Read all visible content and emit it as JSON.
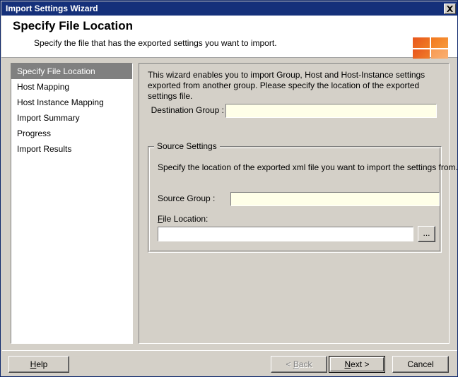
{
  "window": {
    "title": "Import Settings Wizard",
    "close_icon": "close-icon",
    "close_label": "X"
  },
  "header": {
    "title": "Specify File Location",
    "subtitle": "Specify the file that has the exported settings you want to import.",
    "logo_name": "microsoft-logo"
  },
  "sidebar": {
    "items": [
      {
        "label": "Specify File Location",
        "selected": true
      },
      {
        "label": "Host Mapping",
        "selected": false
      },
      {
        "label": "Host Instance Mapping",
        "selected": false
      },
      {
        "label": "Import Summary",
        "selected": false
      },
      {
        "label": "Progress",
        "selected": false
      },
      {
        "label": "Import Results",
        "selected": false
      }
    ]
  },
  "content": {
    "intro": "This wizard enables you to import Group, Host and Host-Instance settings exported from another group. Please specify the location of the exported settings file.",
    "destination_group": {
      "label": "Destination Group :",
      "value": "",
      "placeholder": ""
    },
    "source_settings": {
      "legend": "Source Settings",
      "description": "Specify the location of the exported xml file you want to import the settings from.",
      "source_group": {
        "label": "Source Group :",
        "value": "",
        "placeholder": ""
      },
      "file_location": {
        "label_accel": "F",
        "label_rest": "ile Location:",
        "value": "",
        "placeholder": "",
        "browse_label": "..."
      }
    }
  },
  "footer": {
    "help": {
      "accel": "H",
      "rest": "elp"
    },
    "back": {
      "prefix": "< ",
      "accel": "B",
      "rest": "ack"
    },
    "next": {
      "accel": "N",
      "rest": "ext >"
    },
    "cancel": {
      "label": "Cancel"
    }
  },
  "colors": {
    "titlebar": "#15307a",
    "face": "#d4d0c8",
    "field": "#ffffe8",
    "selected_item": "#808080",
    "accent_orange": "#e8561e"
  }
}
